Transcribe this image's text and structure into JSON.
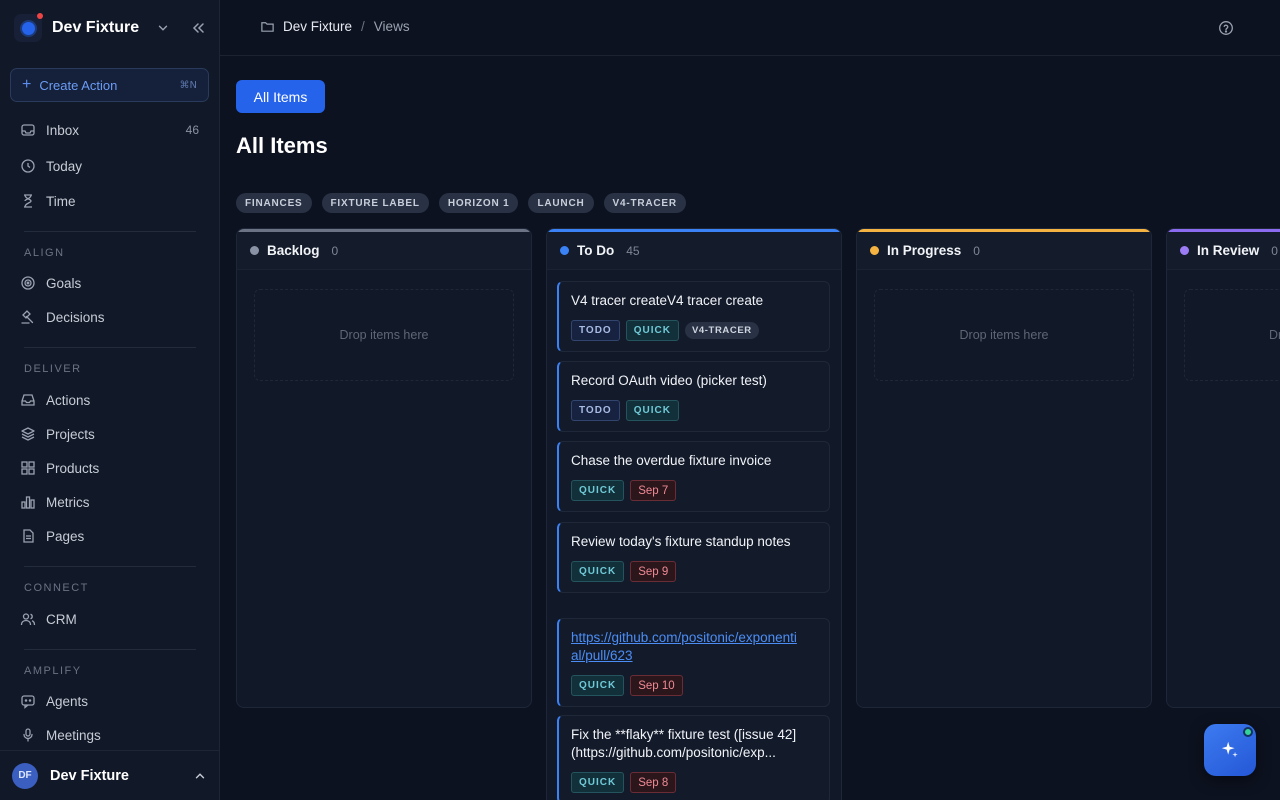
{
  "workspace": {
    "name": "Dev Fixture"
  },
  "sidebar": {
    "create": {
      "label": "Create Action",
      "shortcut": "⌘N"
    },
    "top_items": [
      {
        "label": "Inbox",
        "count": "46",
        "icon": "inbox-icon"
      },
      {
        "label": "Today",
        "icon": "clock-icon"
      },
      {
        "label": "Time",
        "icon": "hourglass-icon"
      }
    ],
    "sections": {
      "align": {
        "title": "ALIGN",
        "items": [
          {
            "label": "Goals",
            "icon": "target-icon"
          },
          {
            "label": "Decisions",
            "icon": "gavel-icon"
          }
        ]
      },
      "deliver": {
        "title": "DELIVER",
        "items": [
          {
            "label": "Actions",
            "icon": "inbox-tray-icon"
          },
          {
            "label": "Projects",
            "icon": "layers-icon"
          },
          {
            "label": "Products",
            "icon": "grid-icon"
          },
          {
            "label": "Metrics",
            "icon": "bar-chart-icon"
          },
          {
            "label": "Pages",
            "icon": "document-icon"
          }
        ]
      },
      "connect": {
        "title": "CONNECT",
        "items": [
          {
            "label": "CRM",
            "icon": "users-icon"
          }
        ]
      },
      "amplify": {
        "title": "AMPLIFY",
        "items": [
          {
            "label": "Agents",
            "icon": "chat-bot-icon"
          },
          {
            "label": "Meetings",
            "icon": "microphone-icon"
          }
        ]
      }
    },
    "user": {
      "initials": "DF",
      "name": "Dev Fixture"
    }
  },
  "breadcrumb": {
    "workspace": "Dev Fixture",
    "separator": "/",
    "current": "Views"
  },
  "view": {
    "tab_label": "All Items",
    "title": "All Items",
    "labels": [
      "FINANCES",
      "FIXTURE LABEL",
      "HORIZON 1",
      "LAUNCH",
      "V4-TRACER"
    ]
  },
  "board": {
    "columns": [
      {
        "name": "Backlog",
        "count": "0",
        "color": "#6b7384",
        "dot": "#8a93a5",
        "empty_text": "Drop items here"
      },
      {
        "name": "To Do",
        "count": "45",
        "color": "#3b82f6",
        "dot": "#3b82f6"
      },
      {
        "name": "In Progress",
        "count": "0",
        "color": "#f5b342",
        "dot": "#f5b342",
        "empty_text": "Drop items here"
      },
      {
        "name": "In Review",
        "count": "0",
        "color": "#8b6cf0",
        "dot": "#9b7cf5",
        "empty_text": "Drop items here"
      }
    ],
    "todo_cards": [
      {
        "title": "V4 tracer createV4 tracer create",
        "tags": [
          "TODO",
          "QUICK",
          "V4-TRACER"
        ]
      },
      {
        "title": "Record OAuth video (picker test)",
        "tags": [
          "TODO",
          "QUICK"
        ]
      },
      {
        "title": "Chase the overdue fixture invoice",
        "tags": [
          "QUICK"
        ],
        "due": "Sep 7"
      },
      {
        "title": "Review today's fixture standup notes",
        "tags": [
          "QUICK"
        ],
        "due": "Sep 9"
      },
      {
        "title": "https://github.com/positonic/exponential/pull/623",
        "tags": [
          "QUICK"
        ],
        "due": "Sep 10"
      },
      {
        "title": "Fix the **flaky** fixture test ([issue 42](https://github.com/positonic/exp...",
        "tags": [
          "QUICK"
        ],
        "due": "Sep 8"
      }
    ]
  },
  "colors": {
    "accent": "#2563eb",
    "background": "#0d1220",
    "sidebar": "#111827"
  }
}
